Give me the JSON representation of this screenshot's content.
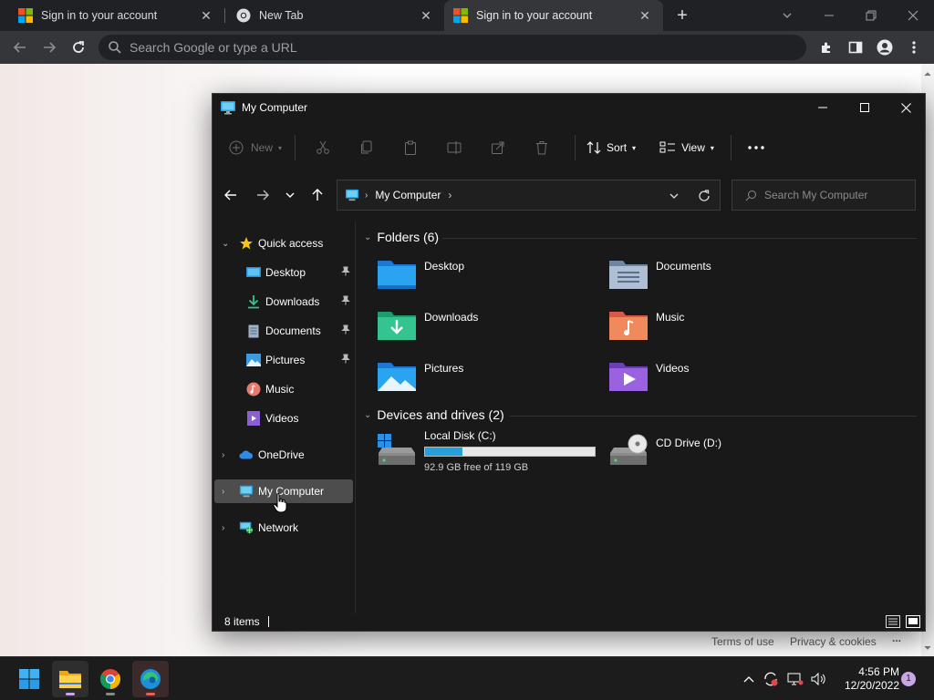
{
  "browser": {
    "tabs": [
      {
        "label": "Sign in to your account",
        "icon": "microsoft-logo-icon"
      },
      {
        "label": "New Tab",
        "icon": "chrome-logo-icon"
      },
      {
        "label": "Sign in to your account",
        "icon": "microsoft-logo-icon"
      }
    ],
    "active_tab": 1,
    "omnibox_placeholder": "Search Google or type a URL",
    "footer": {
      "terms": "Terms of use",
      "privacy": "Privacy & cookies",
      "more": "..."
    }
  },
  "explorer": {
    "title": "My Computer",
    "commands": {
      "new": "New",
      "sort": "Sort",
      "view": "View",
      "more": "..."
    },
    "address": {
      "location": "My Computer"
    },
    "search_placeholder": "Search My Computer",
    "sidebar": {
      "quick_access": "Quick access",
      "items": [
        "Desktop",
        "Downloads",
        "Documents",
        "Pictures",
        "Music",
        "Videos"
      ],
      "onedrive": "OneDrive",
      "my_computer": "My Computer",
      "network": "Network"
    },
    "folders_header": "Folders (6)",
    "folders": [
      "Desktop",
      "Documents",
      "Downloads",
      "Music",
      "Pictures",
      "Videos"
    ],
    "drives_header": "Devices and drives (2)",
    "drives": [
      {
        "name": "Local Disk (C:)",
        "free_text": "92.9 GB free of 119 GB",
        "used_fraction": 0.22
      },
      {
        "name": "CD Drive (D:)"
      }
    ],
    "status": "8 items"
  },
  "taskbar": {
    "time": "4:56 PM",
    "date": "12/20/2022",
    "notifications": "1"
  },
  "colors": {
    "accent": "#26a0da",
    "explorer_bg": "#191919",
    "taskbar_bg": "#1c1c1c",
    "chrome_bg": "#202124"
  }
}
